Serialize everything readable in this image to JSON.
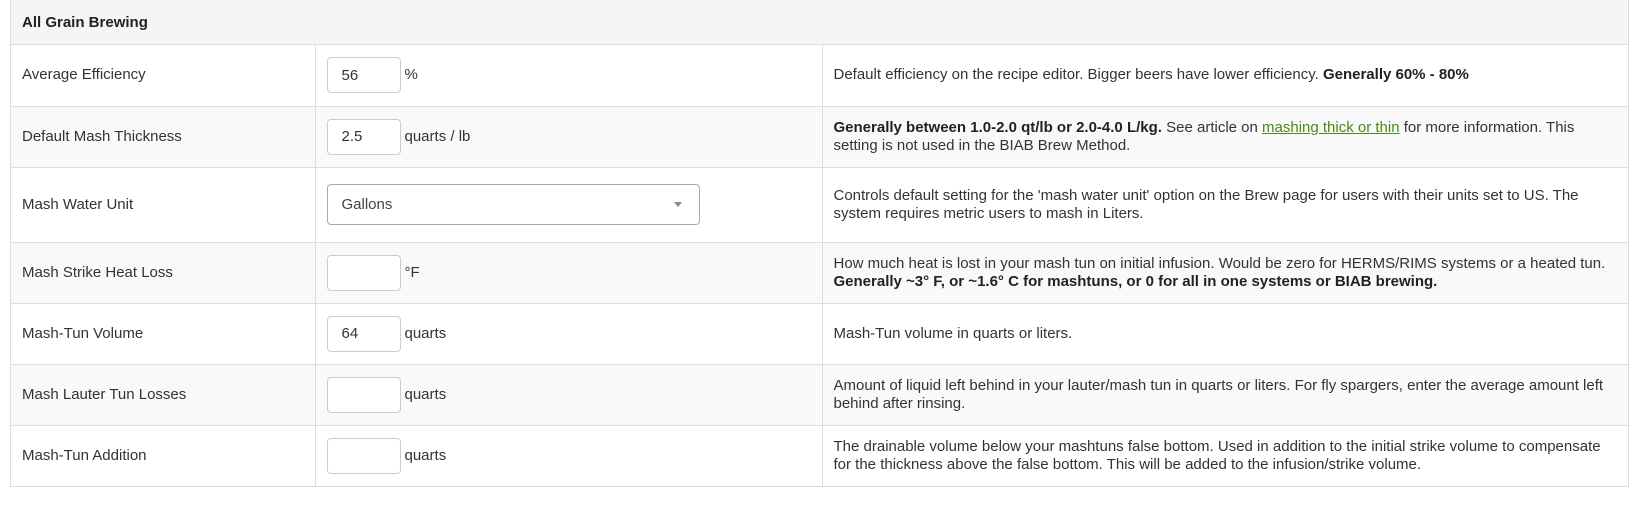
{
  "panel": {
    "title": "All Grain Brewing"
  },
  "rows": {
    "efficiency": {
      "label": "Average Efficiency",
      "value": "56",
      "unit": "%",
      "desc_text": "Default efficiency on the recipe editor. Bigger beers have lower efficiency. ",
      "desc_bold": "Generally 60% - 80%"
    },
    "mash_thickness": {
      "label": "Default Mash Thickness",
      "value": "2.5",
      "unit": "quarts / lb",
      "desc_bold": "Generally between 1.0-2.0 qt/lb or 2.0-4.0 L/kg.",
      "desc_pre_link": " See article on ",
      "desc_link": "mashing thick or thin",
      "desc_post_link": " for more information. This setting is not used in the BIAB Brew Method."
    },
    "mash_water_unit": {
      "label": "Mash Water Unit",
      "selected": "Gallons",
      "desc_text": "Controls default setting for the 'mash water unit' option on the Brew page for users with their units set to US. The system requires metric users to mash in Liters."
    },
    "strike_heat_loss": {
      "label": "Mash Strike Heat Loss",
      "value": "",
      "unit": "°F",
      "desc_text": "How much heat is lost in your mash tun on initial infusion. Would be zero for HERMS/RIMS systems or a heated tun. ",
      "desc_bold": "Generally ~3° F, or ~1.6° C for mashtuns, or 0 for all in one systems or BIAB brewing."
    },
    "mash_tun_volume": {
      "label": "Mash-Tun Volume",
      "value": "64",
      "unit": "quarts",
      "desc_text": "Mash-Tun volume in quarts or liters."
    },
    "lauter_losses": {
      "label": "Mash Lauter Tun Losses",
      "value": "",
      "unit": "quarts",
      "desc_text": "Amount of liquid left behind in your lauter/mash tun in quarts or liters. For fly spargers, enter the average amount left behind after rinsing."
    },
    "mash_tun_addition": {
      "label": "Mash-Tun Addition",
      "value": "",
      "unit": "quarts",
      "desc_text": "The drainable volume below your mashtuns false bottom. Used in addition to the initial strike volume to compensate for the thickness above the false bottom. This will be added to the infusion/strike volume."
    }
  }
}
